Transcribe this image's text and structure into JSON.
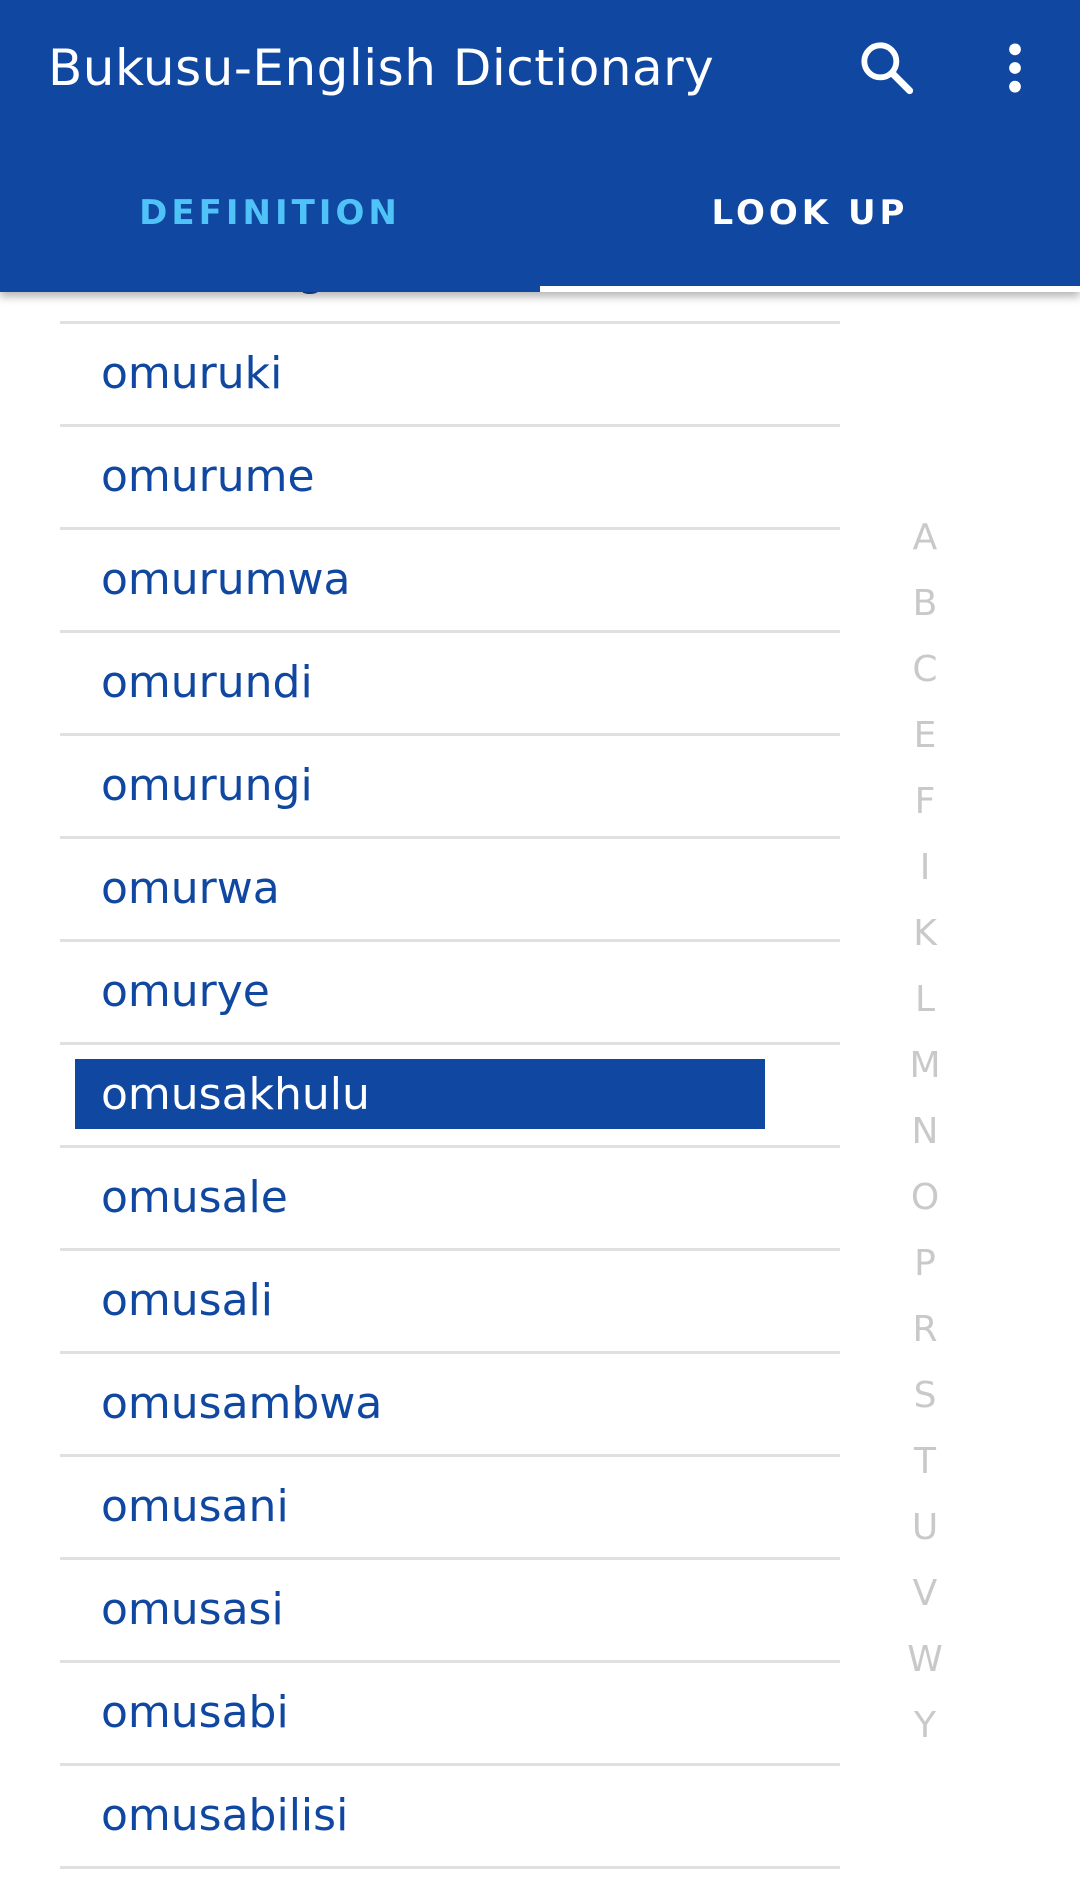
{
  "app": {
    "title": "Bukusu-English Dictionary",
    "accent_color": "#0f47a1",
    "active_tab_text_color": "#ffffff",
    "inactive_tab_text_color": "#4fc3f7"
  },
  "toolbar": {
    "search_icon": "search-icon",
    "more_icon": "more-vert-icon"
  },
  "tabs": [
    {
      "label": "DEFINITION",
      "selected": false
    },
    {
      "label": "LOOK UP",
      "selected": true
    }
  ],
  "word_list": {
    "selected_word": "omusakhulu",
    "items": [
      "omuroongesi",
      "omuruki",
      "omurume",
      "omurumwa",
      "omurundi",
      "omurungi",
      "omurwa",
      "omurye",
      "omusakhulu",
      "omusale",
      "omusali",
      "omusambwa",
      "omusani",
      "omusasi",
      "omusabi",
      "omusabilisi"
    ]
  },
  "alphabet_index": [
    "A",
    "B",
    "C",
    "E",
    "F",
    "I",
    "K",
    "L",
    "M",
    "N",
    "O",
    "P",
    "R",
    "S",
    "T",
    "U",
    "V",
    "W",
    "Y"
  ]
}
